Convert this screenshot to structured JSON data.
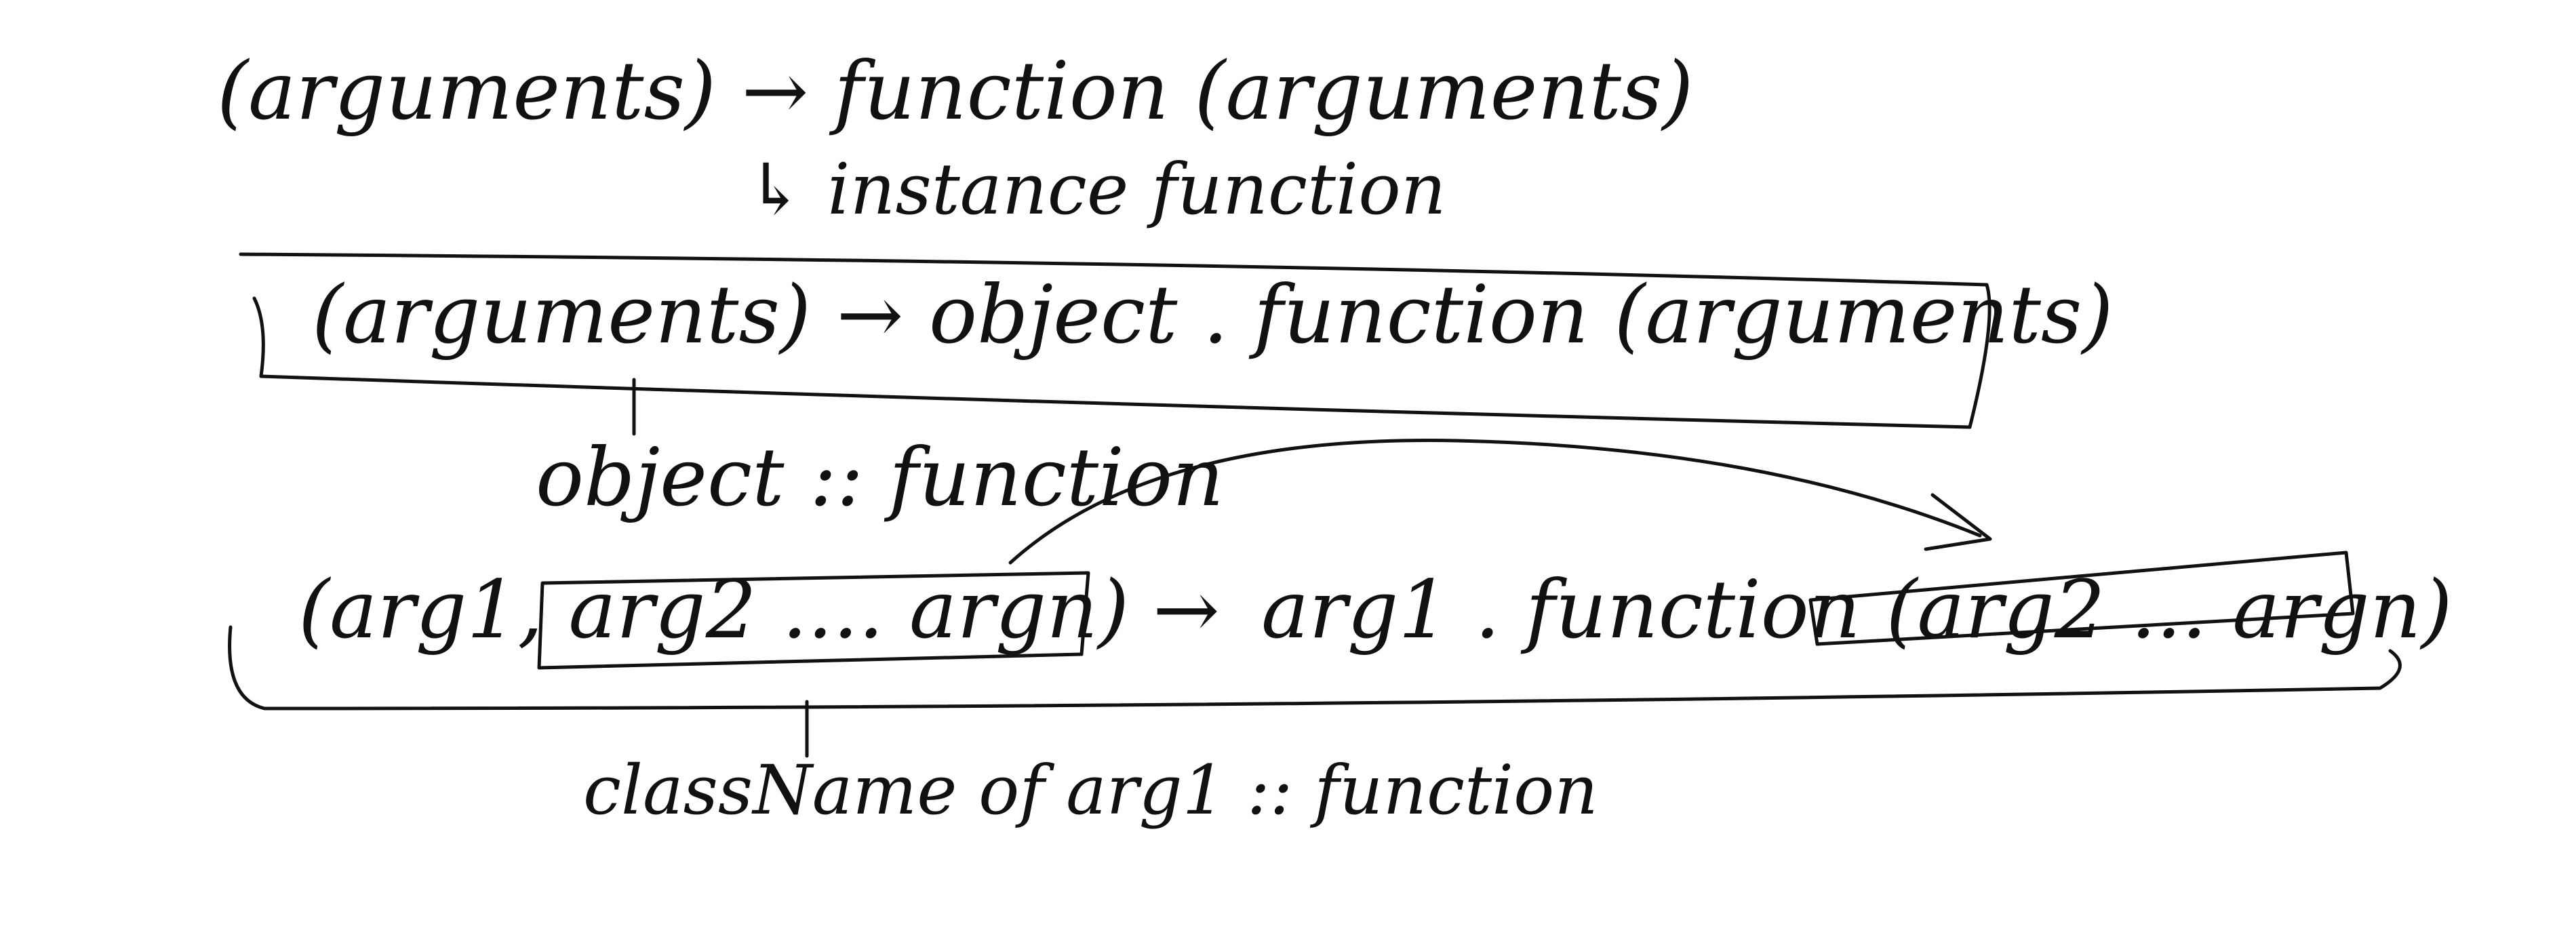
{
  "lines": {
    "line1": "(arguments) → function (arguments)",
    "note1": "↳ instance function",
    "line2": "(arguments) → object . function (arguments)",
    "note2": "object :: function",
    "line3_left": "(arg1, arg2 .... argn)",
    "line3_arrow": "→",
    "line3_right": "arg1 . function (arg2 ... argn)",
    "note3": "className of arg1 :: function"
  },
  "colors": {
    "ink": "#111111",
    "background": "#ffffff"
  }
}
